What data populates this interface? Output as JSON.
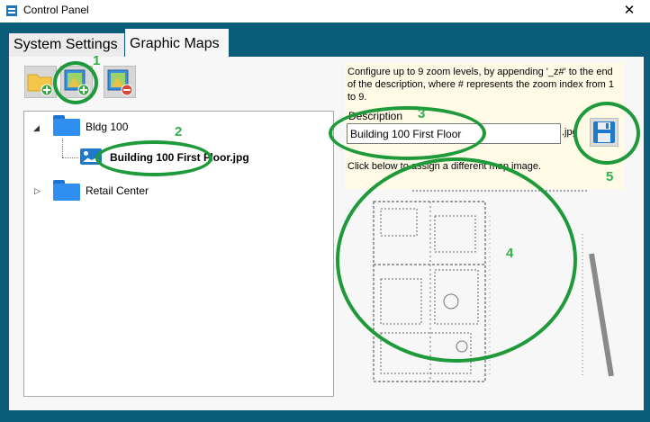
{
  "window": {
    "title": "Control Panel",
    "close_glyph": "✕"
  },
  "tabs": [
    {
      "label": "System Settings",
      "selected": false
    },
    {
      "label": "Graphic Maps",
      "selected": true
    }
  ],
  "toolbar": {
    "buttons": [
      {
        "icon": "add-folder-icon"
      },
      {
        "icon": "add-map-icon"
      },
      {
        "icon": "remove-map-icon"
      }
    ]
  },
  "tree": {
    "items": [
      {
        "label": "Bldg 100",
        "expanded": true,
        "icon": "folder-icon"
      },
      {
        "label": "Building 100 First Floor.jpg",
        "icon": "image-icon"
      },
      {
        "label": "Retail Center",
        "expanded": false,
        "icon": "folder-icon"
      }
    ]
  },
  "details": {
    "info": "Configure up to 9 zoom levels, by appending '_z#' to the end of the description, where # represents the zoom index from 1 to 9.",
    "description_label": "Description",
    "description_value": "Building 100 First Floor",
    "extension": ".jpg",
    "assign_hint": "Click below to assign a different map image."
  },
  "annotations": {
    "numbers": [
      "1",
      "2",
      "3",
      "4",
      "5"
    ],
    "color": "#1f9a3a",
    "number_color": "#2fb24a"
  },
  "colors": {
    "window_bg": "#0b5c78",
    "panel_bg": "#f7f7f7",
    "info_bg": "#fffbe6",
    "folder_blue": "#2f8ff0"
  }
}
